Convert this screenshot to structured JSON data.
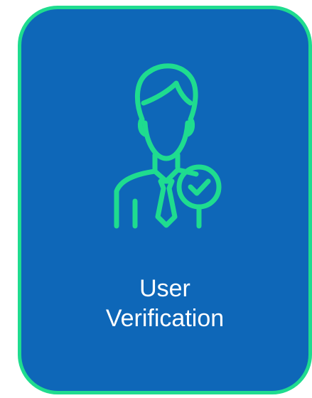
{
  "card": {
    "label_line1": "User",
    "label_line2": "Verification",
    "icon": "verified-user-icon",
    "colors": {
      "background": "#0e67b8",
      "border": "#1fdc8f",
      "icon": "#1fdc8f",
      "text": "#ffffff"
    }
  }
}
